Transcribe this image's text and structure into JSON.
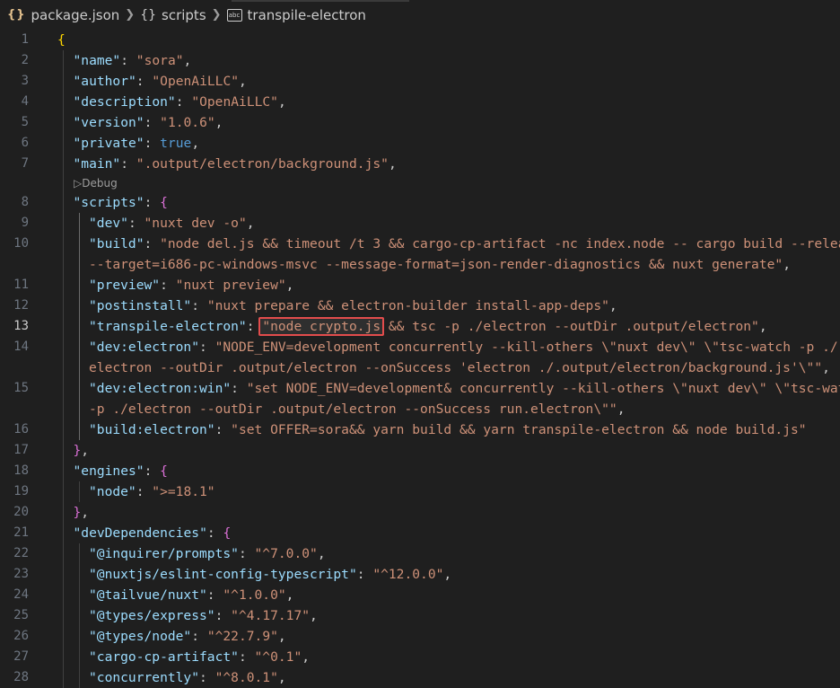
{
  "breadcrumb": {
    "json_icon": "{}",
    "braces_icon": "{}",
    "field_icon": "abc",
    "file": "package.json",
    "section": "scripts",
    "item": "transpile-electron"
  },
  "codelens": {
    "label": "Debug"
  },
  "editor": {
    "active_line": "13",
    "lines": [
      {
        "n": "1",
        "indent": 0,
        "parts": [
          [
            "b1",
            "{"
          ]
        ]
      },
      {
        "n": "2",
        "indent": 1,
        "parts": [
          [
            "k",
            "\"name\""
          ],
          [
            "p",
            ": "
          ],
          [
            "s",
            "\"sora\""
          ],
          [
            "p",
            ","
          ]
        ]
      },
      {
        "n": "3",
        "indent": 1,
        "parts": [
          [
            "k",
            "\"author\""
          ],
          [
            "p",
            ": "
          ],
          [
            "s",
            "\"OpenAiLLC\""
          ],
          [
            "p",
            ","
          ]
        ]
      },
      {
        "n": "4",
        "indent": 1,
        "parts": [
          [
            "k",
            "\"description\""
          ],
          [
            "p",
            ": "
          ],
          [
            "s",
            "\"OpenAiLLC\""
          ],
          [
            "p",
            ","
          ]
        ]
      },
      {
        "n": "5",
        "indent": 1,
        "parts": [
          [
            "k",
            "\"version\""
          ],
          [
            "p",
            ": "
          ],
          [
            "s",
            "\"1.0.6\""
          ],
          [
            "p",
            ","
          ]
        ]
      },
      {
        "n": "6",
        "indent": 1,
        "parts": [
          [
            "k",
            "\"private\""
          ],
          [
            "p",
            ": "
          ],
          [
            "kw",
            "true"
          ],
          [
            "p",
            ","
          ]
        ]
      },
      {
        "n": "7",
        "indent": 1,
        "parts": [
          [
            "k",
            "\"main\""
          ],
          [
            "p",
            ": "
          ],
          [
            "s",
            "\".output/electron/background.js\""
          ],
          [
            "p",
            ","
          ]
        ]
      },
      {
        "lens": true
      },
      {
        "n": "8",
        "indent": 1,
        "parts": [
          [
            "k",
            "\"scripts\""
          ],
          [
            "p",
            ": "
          ],
          [
            "b2",
            "{"
          ]
        ]
      },
      {
        "n": "9",
        "indent": 2,
        "parts": [
          [
            "k",
            "\"dev\""
          ],
          [
            "p",
            ": "
          ],
          [
            "s",
            "\"nuxt dev -o\""
          ],
          [
            "p",
            ","
          ]
        ]
      },
      {
        "n": "10",
        "indent": 2,
        "parts": [
          [
            "k",
            "\"build\""
          ],
          [
            "p",
            ": "
          ],
          [
            "s",
            "\"node del.js && timeout /t 3 && cargo-cp-artifact -nc index.node -- cargo build --release"
          ]
        ]
      },
      {
        "n": "",
        "indent": 2,
        "parts": [
          [
            "s",
            "--target=i686-pc-windows-msvc --message-format=json-render-diagnostics && nuxt generate\""
          ],
          [
            "p",
            ","
          ]
        ]
      },
      {
        "n": "11",
        "indent": 2,
        "parts": [
          [
            "k",
            "\"preview\""
          ],
          [
            "p",
            ": "
          ],
          [
            "s",
            "\"nuxt preview\""
          ],
          [
            "p",
            ","
          ]
        ]
      },
      {
        "n": "12",
        "indent": 2,
        "parts": [
          [
            "k",
            "\"postinstall\""
          ],
          [
            "p",
            ": "
          ],
          [
            "s",
            "\"nuxt prepare && electron-builder install-app-deps\""
          ],
          [
            "p",
            ","
          ]
        ]
      },
      {
        "n": "13",
        "indent": 2,
        "parts": [
          [
            "k",
            "\"transpile-electron\""
          ],
          [
            "p",
            ": "
          ],
          [
            "hl",
            "\"node crypto.js"
          ],
          [
            "s",
            " && tsc -p ./electron --outDir .output/electron\""
          ],
          [
            "p",
            ","
          ]
        ]
      },
      {
        "n": "14",
        "indent": 2,
        "parts": [
          [
            "k",
            "\"dev:electron\""
          ],
          [
            "p",
            ": "
          ],
          [
            "s",
            "\"NODE_ENV=development concurrently --kill-others \\\"nuxt dev\\\" \\\"tsc-watch -p ./"
          ]
        ]
      },
      {
        "n": "",
        "indent": 2,
        "parts": [
          [
            "s",
            "electron --outDir .output/electron --onSuccess 'electron ./.output/electron/background.js'\\\"\""
          ],
          [
            "p",
            ","
          ]
        ]
      },
      {
        "n": "15",
        "indent": 2,
        "parts": [
          [
            "k",
            "\"dev:electron:win\""
          ],
          [
            "p",
            ": "
          ],
          [
            "s",
            "\"set NODE_ENV=development& concurrently --kill-others \\\"nuxt dev\\\" \\\"tsc-watch"
          ]
        ]
      },
      {
        "n": "",
        "indent": 2,
        "parts": [
          [
            "s",
            "-p ./electron --outDir .output/electron --onSuccess run.electron\\\"\""
          ],
          [
            "p",
            ","
          ]
        ]
      },
      {
        "n": "16",
        "indent": 2,
        "parts": [
          [
            "k",
            "\"build:electron\""
          ],
          [
            "p",
            ": "
          ],
          [
            "s",
            "\"set OFFER=sora&& yarn build && yarn transpile-electron && node build.js\""
          ]
        ]
      },
      {
        "n": "17",
        "indent": 1,
        "parts": [
          [
            "b2",
            "}"
          ],
          [
            "p",
            ","
          ]
        ]
      },
      {
        "n": "18",
        "indent": 1,
        "parts": [
          [
            "k",
            "\"engines\""
          ],
          [
            "p",
            ": "
          ],
          [
            "b2",
            "{"
          ]
        ]
      },
      {
        "n": "19",
        "indent": 2,
        "parts": [
          [
            "k",
            "\"node\""
          ],
          [
            "p",
            ": "
          ],
          [
            "s",
            "\">=18.1\""
          ]
        ]
      },
      {
        "n": "20",
        "indent": 1,
        "parts": [
          [
            "b2",
            "}"
          ],
          [
            "p",
            ","
          ]
        ]
      },
      {
        "n": "21",
        "indent": 1,
        "parts": [
          [
            "k",
            "\"devDependencies\""
          ],
          [
            "p",
            ": "
          ],
          [
            "b2",
            "{"
          ]
        ]
      },
      {
        "n": "22",
        "indent": 2,
        "parts": [
          [
            "k",
            "\"@inquirer/prompts\""
          ],
          [
            "p",
            ": "
          ],
          [
            "s",
            "\"^7.0.0\""
          ],
          [
            "p",
            ","
          ]
        ]
      },
      {
        "n": "23",
        "indent": 2,
        "parts": [
          [
            "k",
            "\"@nuxtjs/eslint-config-typescript\""
          ],
          [
            "p",
            ": "
          ],
          [
            "s",
            "\"^12.0.0\""
          ],
          [
            "p",
            ","
          ]
        ]
      },
      {
        "n": "24",
        "indent": 2,
        "parts": [
          [
            "k",
            "\"@tailvue/nuxt\""
          ],
          [
            "p",
            ": "
          ],
          [
            "s",
            "\"^1.0.0\""
          ],
          [
            "p",
            ","
          ]
        ]
      },
      {
        "n": "25",
        "indent": 2,
        "parts": [
          [
            "k",
            "\"@types/express\""
          ],
          [
            "p",
            ": "
          ],
          [
            "s",
            "\"^4.17.17\""
          ],
          [
            "p",
            ","
          ]
        ]
      },
      {
        "n": "26",
        "indent": 2,
        "parts": [
          [
            "k",
            "\"@types/node\""
          ],
          [
            "p",
            ": "
          ],
          [
            "s",
            "\"^22.7.9\""
          ],
          [
            "p",
            ","
          ]
        ]
      },
      {
        "n": "27",
        "indent": 2,
        "parts": [
          [
            "k",
            "\"cargo-cp-artifact\""
          ],
          [
            "p",
            ": "
          ],
          [
            "s",
            "\"^0.1\""
          ],
          [
            "p",
            ","
          ]
        ]
      },
      {
        "n": "28",
        "indent": 2,
        "parts": [
          [
            "k",
            "\"concurrently\""
          ],
          [
            "p",
            ": "
          ],
          [
            "s",
            "\"^8.0.1\""
          ],
          [
            "p",
            ","
          ]
        ]
      }
    ]
  },
  "colors": {
    "background": "#1f1f1f",
    "key": "#9cdcfe",
    "string": "#ce9178",
    "highlight_border": "#e24c4c"
  }
}
